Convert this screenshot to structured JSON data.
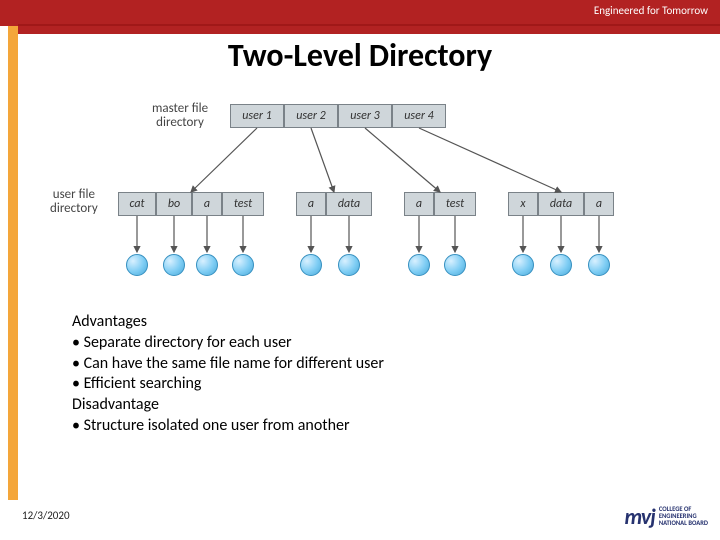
{
  "header": {
    "tagline": "Engineered for Tomorrow",
    "title": "Two-Level Directory"
  },
  "diagram": {
    "mfd_label_line1": "master file",
    "mfd_label_line2": "directory",
    "ufd_label_line1": "user file",
    "ufd_label_line2": "directory",
    "mfd": [
      "user 1",
      "user 2",
      "user 3",
      "user 4"
    ],
    "ufd_groups": [
      [
        "cat",
        "bo",
        "a",
        "test"
      ],
      [
        "a",
        "data"
      ],
      [
        "a",
        "test"
      ],
      [
        "x",
        "data",
        "a"
      ]
    ]
  },
  "content": {
    "adv_heading": "Advantages",
    "adv1": "• Separate directory for each user",
    "adv2": "• Can have the same file name for different user",
    "adv3": "• Efficient searching",
    "dis_heading": "Disadvantage",
    "dis1": "• Structure isolated one user from another"
  },
  "footer": {
    "date": "12/3/2020",
    "logo_mark": "mvj",
    "logo_line1": "College of",
    "logo_line2": "Engineering",
    "logo_line3": "National Board"
  }
}
